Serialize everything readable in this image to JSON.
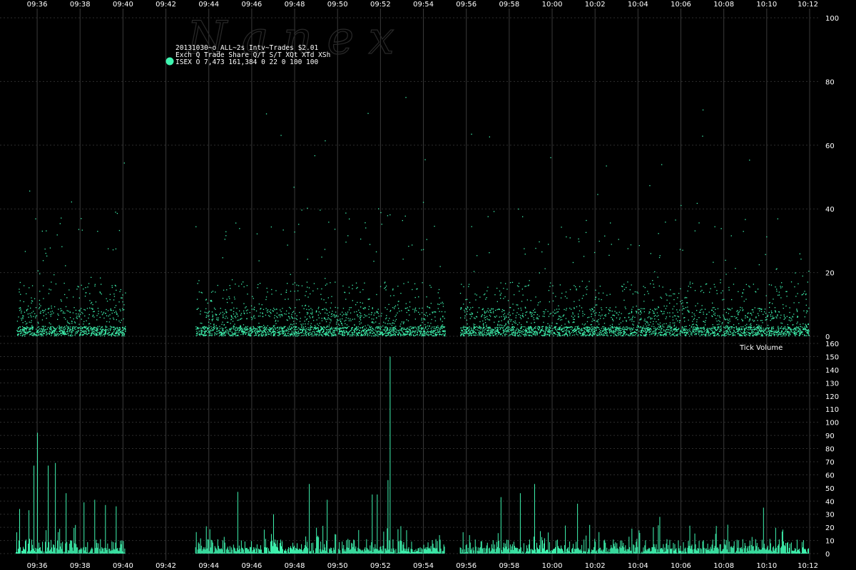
{
  "watermark": "N a n e x",
  "legend": {
    "title": "20131030~o_ALL~2s Intv~Trades $2.01",
    "header": "Exch Q Trade   Share  Q/T   S/T  XQt XTd XSh",
    "row": "ISEX O 7,473 161,384     0    22   0 100 100",
    "marker_color": "#3ff5b0"
  },
  "colors": {
    "series": "#3ff5b0",
    "background": "#000000",
    "text": "#ffffff"
  },
  "chart_data": [
    {
      "type": "scatter",
      "panel": "top",
      "series": [
        {
          "name": "ISEX"
        }
      ],
      "x_ticks": [
        "09:36",
        "09:38",
        "09:40",
        "09:42",
        "09:44",
        "09:46",
        "09:48",
        "09:50",
        "09:52",
        "09:54",
        "09:56",
        "09:58",
        "10:00",
        "10:02",
        "10:04",
        "10:06",
        "10:08",
        "10:10",
        "10:12"
      ],
      "x_range": [
        "09:35:00",
        "10:12:00"
      ],
      "ylim": [
        0,
        100
      ],
      "y_ticks": [
        0,
        20,
        40,
        60,
        80,
        100
      ],
      "gaps": [
        [
          "09:40:05",
          "09:43:20"
        ],
        [
          "09:55:00",
          "09:55:40"
        ]
      ],
      "density_profile": "dense cluster of trades near 0-15 size; scattered points up to ~60, isolated outliers near 80-100"
    },
    {
      "type": "bar",
      "panel": "bottom",
      "ylabel": "Tick Volume",
      "series": [
        {
          "name": "ISEX"
        }
      ],
      "x_ticks": [
        "09:36",
        "09:38",
        "09:40",
        "09:42",
        "09:44",
        "09:46",
        "09:48",
        "09:50",
        "09:52",
        "09:54",
        "09:56",
        "09:58",
        "10:00",
        "10:02",
        "10:04",
        "10:06",
        "10:08",
        "10:10",
        "10:12"
      ],
      "ylim": [
        0,
        160
      ],
      "y_ticks": [
        0,
        10,
        20,
        30,
        40,
        50,
        60,
        70,
        80,
        90,
        100,
        110,
        120,
        130,
        140,
        150,
        160
      ],
      "peaks": [
        {
          "x": "09:35:10",
          "y": 34
        },
        {
          "x": "09:35:35",
          "y": 33
        },
        {
          "x": "09:35:50",
          "y": 67
        },
        {
          "x": "09:36:00",
          "y": 92
        },
        {
          "x": "09:36:30",
          "y": 67
        },
        {
          "x": "09:36:50",
          "y": 69
        },
        {
          "x": "09:37:20",
          "y": 46
        },
        {
          "x": "09:38:10",
          "y": 39
        },
        {
          "x": "09:38:40",
          "y": 41
        },
        {
          "x": "09:39:10",
          "y": 37
        },
        {
          "x": "09:39:40",
          "y": 36
        },
        {
          "x": "09:45:20",
          "y": 47
        },
        {
          "x": "09:47:00",
          "y": 30
        },
        {
          "x": "09:48:40",
          "y": 53
        },
        {
          "x": "09:49:30",
          "y": 41
        },
        {
          "x": "09:51:35",
          "y": 45
        },
        {
          "x": "09:51:50",
          "y": 45
        },
        {
          "x": "09:52:20",
          "y": 56
        },
        {
          "x": "09:52:25",
          "y": 150
        },
        {
          "x": "09:57:35",
          "y": 43
        },
        {
          "x": "09:58:30",
          "y": 46
        },
        {
          "x": "09:59:10",
          "y": 53
        },
        {
          "x": "10:01:10",
          "y": 38
        },
        {
          "x": "10:05:00",
          "y": 28
        },
        {
          "x": "10:08:10",
          "y": 22
        },
        {
          "x": "10:09:50",
          "y": 35
        }
      ]
    }
  ]
}
